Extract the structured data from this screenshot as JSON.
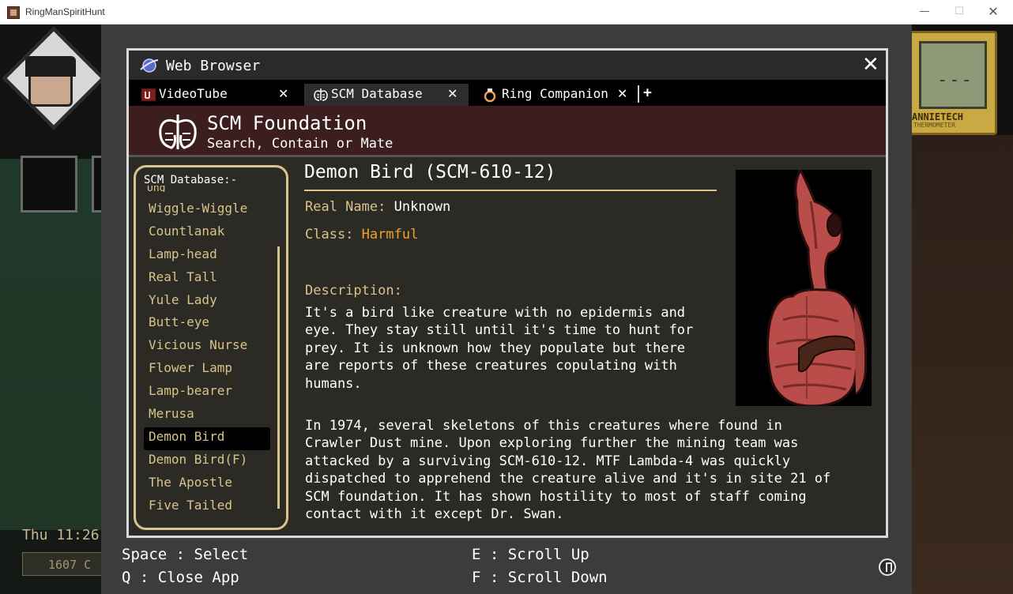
{
  "window": {
    "title": "RingManSpiritHunt",
    "minimize": "—",
    "maximize": "☐",
    "close": "✕"
  },
  "hud": {
    "clock": "Thu 11:26",
    "counter": "1607 C",
    "device_reading": "---",
    "device_brand": "ANNIETECH",
    "device_sub": "THERMOMETER"
  },
  "browser": {
    "title": "Web Browser",
    "close": "✕",
    "tabs": [
      {
        "label": "VideoTube",
        "close": "✕",
        "icon": "videotube-icon"
      },
      {
        "label": "SCM Database",
        "close": "✕",
        "icon": "scm-logo-icon",
        "active": true
      },
      {
        "label": "Ring Companion",
        "close": "✕",
        "icon": "ring-icon"
      }
    ],
    "new_tab": "+"
  },
  "site": {
    "name": "SCM Foundation",
    "tagline": "Search, Contain or Mate"
  },
  "sidebar": {
    "title": "SCM Database:-",
    "clipped_item": "Ung",
    "items": [
      "Wiggle-Wiggle",
      "Countlanak",
      "Lamp-head",
      "Real Tall",
      "Yule Lady",
      "Butt-eye",
      "Vicious Nurse",
      "Flower Lamp",
      "Lamp-bearer",
      "Merusa",
      "Demon Bird",
      "Demon Bird(F)",
      "The Apostle",
      "Five Tailed"
    ],
    "selected": "Demon Bird"
  },
  "entry": {
    "title": "Demon Bird (SCM-610-12)",
    "real_name_label": "Real Name:",
    "real_name": "Unknown",
    "class_label": "Class:",
    "class_value": "Harmful",
    "description_label": "Description:",
    "description": "It's a bird like creature with no epidermis and\neye. They stay still until it's time to hunt for\nprey. It is unknown how they populate but there\nare reports of these creatures copulating with\nhumans.",
    "history": "In 1974, several skeletons of this creatures where found in\nCrawler Dust mine. Upon exploring further the mining team was\nattacked by a surviving SCM-610-12. MTF Lambda-4 was quickly\ndispatched to apprehend the creature alive and it's in site 21 of\nSCM foundation. It has shown hostility to most of staff coming\ncontact with it except Dr. Swan."
  },
  "controls": {
    "select": "Space : Select",
    "close_app": "Q : Close App",
    "scroll_up": "E : Scroll Up",
    "scroll_down": "F : Scroll Down"
  },
  "colors": {
    "accent_gold": "#d8c48a",
    "harmful_orange": "#f0a32c",
    "header_maroon": "#3b1e1d",
    "panel_dark": "#2b2a24",
    "creature_red": "#b84d4a"
  }
}
